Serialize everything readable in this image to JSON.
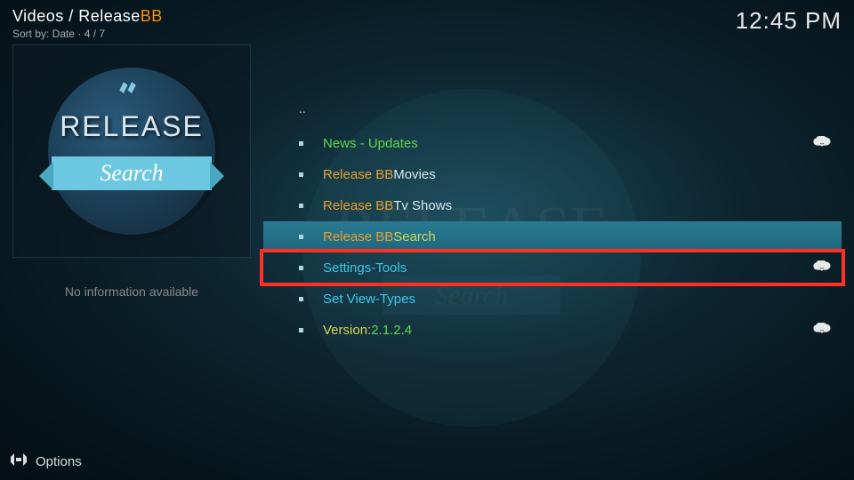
{
  "header": {
    "breadcrumb_prefix": "Videos / Release",
    "breadcrumb_accent": "BB",
    "sort_label": "Sort by: Date  ·  4 / 7",
    "clock": "12:45 PM"
  },
  "sidebar": {
    "no_info": "No information available",
    "logo_title": "RELEASE",
    "logo_subtitle": "Search"
  },
  "list": {
    "parent_dots": "..",
    "items": [
      {
        "prefix": "",
        "label": "News - Updates",
        "prefix_class": "",
        "label_class": "c-green",
        "has_download": true,
        "selected": false
      },
      {
        "prefix": "Release BB ",
        "label": "Movies",
        "prefix_class": "c-orange",
        "label_class": "c-white",
        "has_download": false,
        "selected": false
      },
      {
        "prefix": "Release BB ",
        "label": "Tv Shows",
        "prefix_class": "c-orange",
        "label_class": "c-white",
        "has_download": false,
        "selected": false
      },
      {
        "prefix": "Release BB ",
        "label": "Search",
        "prefix_class": "c-orange",
        "label_class": "c-yellow",
        "has_download": false,
        "selected": true
      },
      {
        "prefix": "",
        "label": "Settings-Tools",
        "prefix_class": "",
        "label_class": "c-cyan",
        "has_download": true,
        "selected": false
      },
      {
        "prefix": "",
        "label": "Set View-Types",
        "prefix_class": "",
        "label_class": "c-cyan",
        "has_download": false,
        "selected": false
      },
      {
        "prefix": "Version: ",
        "label": "2.1.2.4",
        "prefix_class": "c-yellow",
        "label_class": "c-green",
        "has_download": true,
        "selected": false
      }
    ]
  },
  "footer": {
    "options_label": "Options"
  }
}
